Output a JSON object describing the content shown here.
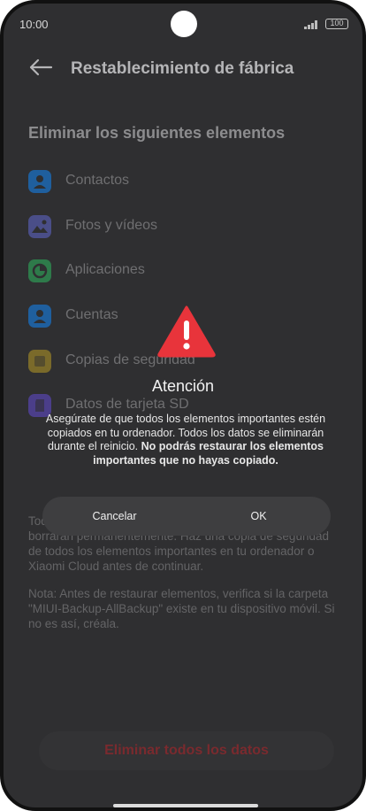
{
  "status_bar": {
    "time": "10:00",
    "battery": "100"
  },
  "header": {
    "title": "Restablecimiento de fábrica"
  },
  "section_title": "Eliminar los siguientes elementos",
  "items": [
    {
      "label": "Contactos",
      "icon": "contacts-icon",
      "color": "#1f5f9e"
    },
    {
      "label": "Fotos y vídeos",
      "icon": "photos-icon",
      "color": "#4a4e88"
    },
    {
      "label": "Aplicaciones",
      "icon": "apps-icon",
      "color": "#2e7a4a"
    },
    {
      "label": "Cuentas",
      "icon": "accounts-icon",
      "color": "#1f5f9e"
    },
    {
      "label": "Copias de seguridad",
      "icon": "backup-icon",
      "color": "#7a6a2a"
    },
    {
      "label": "Datos de tarjeta SD",
      "icon": "sdcard-icon",
      "color": "#4b3e8a"
    }
  ],
  "description_1": "Todos los elementos enumerados anteriormente se borrarán permanentemente. Haz una copia de seguridad de todos los elementos importantes en tu ordenador o Xiaomi Cloud antes de continuar.",
  "description_2": "Nota: Antes de restaurar elementos, verifica si la carpeta \"MIUI-Backup-AllBackup\" existe en tu dispositivo móvil. Si no es así, créala.",
  "erase_button": "Eliminar todos los datos",
  "dialog": {
    "title": "Atención",
    "message_plain": "Asegúrate de que todos los elementos importantes estén copiados en tu ordenador. Todos los datos se eliminarán durante el reinicio.",
    "message_bold": "No podrás restaurar los elementos importantes que no hayas copiado.",
    "cancel": "Cancelar",
    "ok": "OK",
    "warning_color": "#e8343b"
  }
}
